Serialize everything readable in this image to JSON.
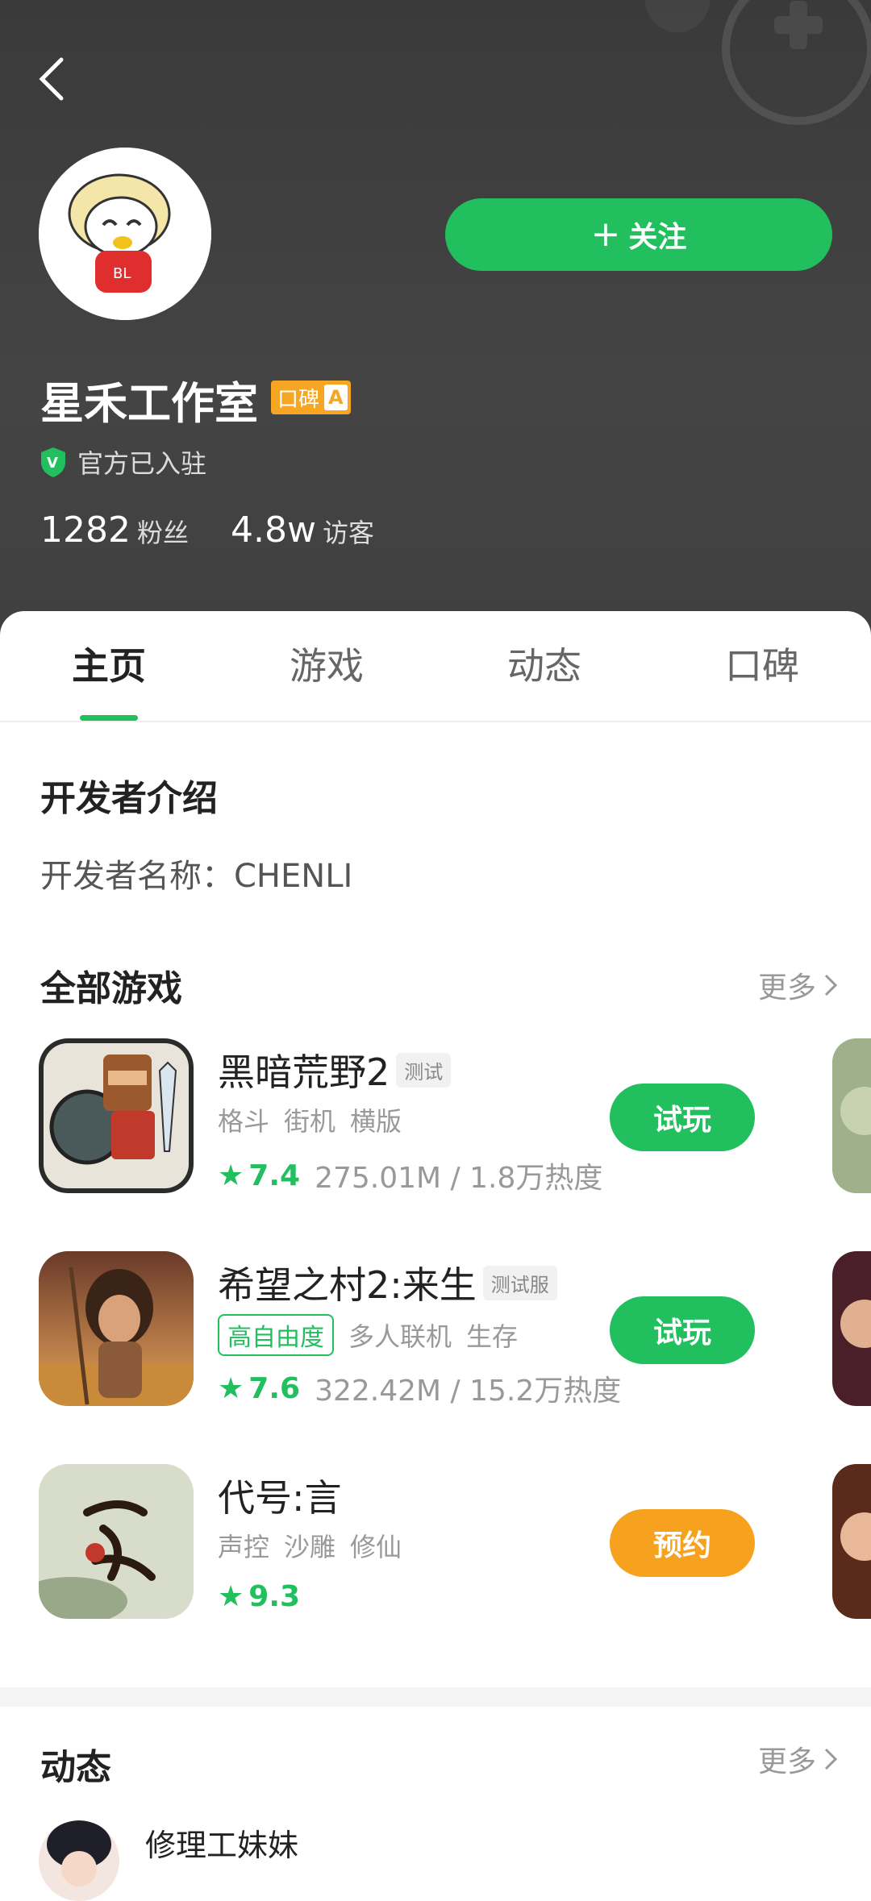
{
  "header": {
    "name": "星禾工作室",
    "badge_label": "口碑",
    "badge_grade": "A",
    "verified_text": "官方已入驻",
    "follow_label": "关注",
    "stats": [
      {
        "value": "1282",
        "label": "粉丝"
      },
      {
        "value": "4.8w",
        "label": "访客"
      }
    ]
  },
  "tabs": [
    "主页",
    "游戏",
    "动态",
    "口碑"
  ],
  "developer": {
    "section_title": "开发者介绍",
    "name_line": "开发者名称：CHENLI"
  },
  "games_section": {
    "title": "全部游戏",
    "more_label": "更多",
    "games": [
      {
        "name": "黑暗荒野2",
        "tag": "测试",
        "tags": [
          "格斗",
          "街机",
          "横版"
        ],
        "highlight": "",
        "rating": "7.4",
        "meta": "275.01M / 1.8万热度",
        "button": "试玩",
        "button_color": "#22bf5f"
      },
      {
        "name": "希望之村2:来生",
        "tag": "测试服",
        "tags": [
          "多人联机",
          "生存"
        ],
        "highlight": "高自由度",
        "rating": "7.6",
        "meta": "322.42M / 15.2万热度",
        "button": "试玩",
        "button_color": "#22bf5f"
      },
      {
        "name": "代号:言",
        "tag": "",
        "tags": [
          "声控",
          "沙雕",
          "修仙"
        ],
        "highlight": "",
        "rating": "9.3",
        "meta": "",
        "button": "预约",
        "button_color": "#f7a21f"
      }
    ]
  },
  "feed_section": {
    "title": "动态",
    "more_label": "更多",
    "first_author": "修理工妹妹"
  },
  "colors": {
    "accent": "#22bf5f",
    "orange": "#f7a21f",
    "badge": "#f6a623"
  }
}
